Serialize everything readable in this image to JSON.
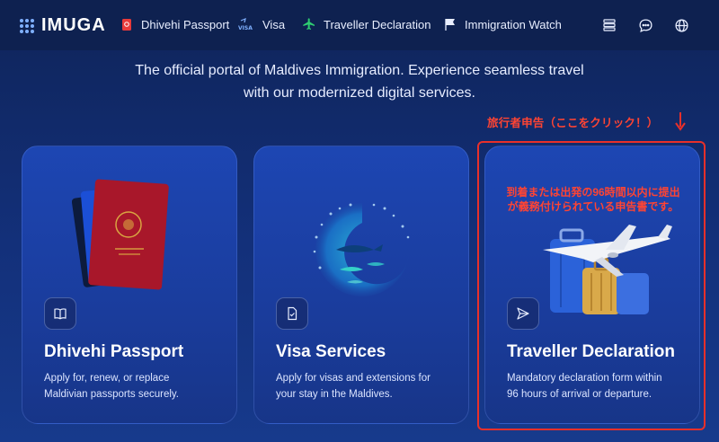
{
  "brand": {
    "name": "IMUGA"
  },
  "nav": {
    "items": [
      {
        "label": "Dhivehi Passport",
        "icon": "passport-icon"
      },
      {
        "label": "Visa",
        "icon": "visa-icon"
      },
      {
        "label": "Traveller Declaration",
        "icon": "plane-icon"
      },
      {
        "label": "Immigration Watch",
        "icon": "flag-icon"
      }
    ],
    "right_icons": [
      "server-icon",
      "chat-icon",
      "globe-icon"
    ]
  },
  "hero": {
    "line1": "The official portal of Maldives Immigration. Experience seamless travel",
    "line2": "with our modernized digital services."
  },
  "annotation": {
    "label": "旅行者申告（ここをクリック！）",
    "note_line1": "到着または出発の96時間以内に提出",
    "note_line2": "が義務付けられている申告書です。",
    "color": "#e8302a"
  },
  "cards": [
    {
      "title": "Dhivehi Passport",
      "desc_line1": "Apply for, renew, or replace",
      "desc_line2": "Maldivian passports securely.",
      "icon": "book-open-icon"
    },
    {
      "title": "Visa Services",
      "desc_line1": "Apply for visas and extensions for",
      "desc_line2": "your stay in the Maldives.",
      "icon": "document-check-icon"
    },
    {
      "title": "Traveller Declaration",
      "desc_line1": "Mandatory declaration form within",
      "desc_line2": "96 hours of arrival or departure.",
      "icon": "send-icon"
    }
  ],
  "colors": {
    "bg_top": "#0f2459",
    "card": "#1d46b3",
    "accent_red": "#e8302a"
  }
}
